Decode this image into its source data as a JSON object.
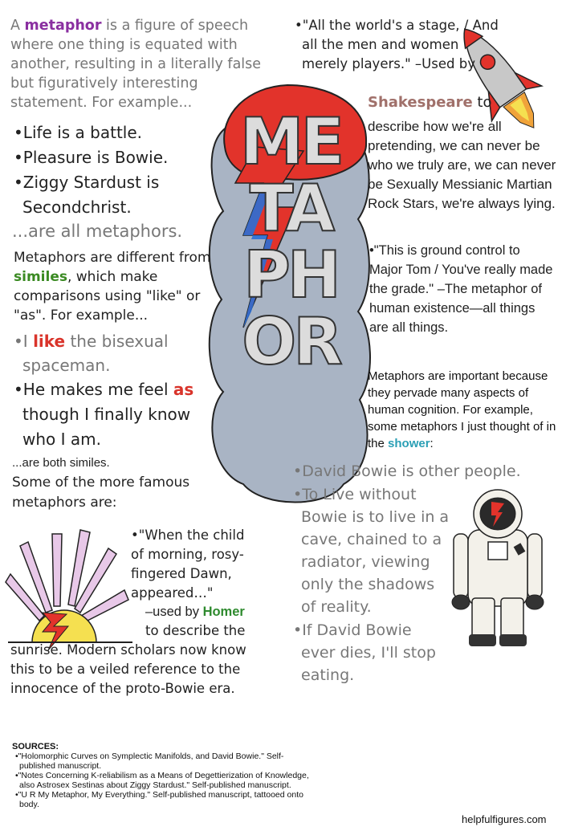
{
  "intro": {
    "a": "A ",
    "metaphor_word": "metaphor",
    "rest": " is a figure of speech where one thing is equated with another, resulting in a literally false but figuratively interesting statement. For example..."
  },
  "examples": [
    "•Life is a battle.",
    "•Pleasure is Bowie.",
    "•Ziggy Stardust is",
    "Secondchrist."
  ],
  "all_metaphors": "...are all metaphors.",
  "different": {
    "a": "Metaphors are different from ",
    "similes_word": "similes",
    "b": ", which make comparisons using \"like\" or \"as\". For example..."
  },
  "simile1": {
    "a": "•I ",
    "like_word": "like",
    "b": " the bisexual",
    "c": "spaceman."
  },
  "simile2": {
    "a": "•He makes me feel ",
    "as_word": "as",
    "b": "though I finally know",
    "c": "who I am."
  },
  "both_similes": "...are both similes.",
  "famous": "Some of the more famous metaphors are:",
  "homer": {
    "quote": "•\"When the child of morning, rosy-fingered Dawn, appeared…\"",
    "used_by": "–used by ",
    "name": "Homer",
    "rest": " to describe the sunrise. Modern scholars now know this to be a veiled reference to the innocence of the proto-Bowie era."
  },
  "shakespeare": {
    "quote": "•\"All the world's a stage, / And all the men and women merely players.\" –Used by",
    "name": "Shakespeare",
    "to": " to",
    "rest": "describe how we're all pretending, we can never be who we truly are, we can never be Sexually Messianic Martian Rock Stars, we're always lying."
  },
  "ground": "•\"This is ground control to Major Tom / You've really made the grade.\" –The metaphor of human existence—all things are all things.",
  "important": {
    "a": "Metaphors are important because they pervade many aspects of human cognition. For example, some metaphors I just thought of in the ",
    "shower_word": "shower",
    "b": ":"
  },
  "bowie_list": [
    "•David Bowie is other people.",
    "•To Live without Bowie is to live in a cave, chained to a radiator, viewing only the shadows of reality.",
    "•If David Bowie ever dies, I'll stop eating."
  ],
  "title_rows": [
    "ME",
    "TA",
    "PH",
    "OR"
  ],
  "sources": {
    "heading": "SOURCES:",
    "items": [
      "•\"Holomorphic Curves on Symplectic Manifolds, and David Bowie.\" Self-published manuscript.",
      "•\"Notes Concerning K-reliabilism as a Means of Degettierization of Knowledge, also Astrosex Sestinas about Ziggy Stardust.\" Self-published manuscript.",
      "•\"U R My Metaphor, My Everything.\" Self-published manuscript, tattooed onto body."
    ]
  },
  "site": "helpfulfigures.com",
  "colors": {
    "accent_red": "#e2332b",
    "cloud": "#a9b4c4",
    "bolt_blue": "#2b6fd6"
  }
}
